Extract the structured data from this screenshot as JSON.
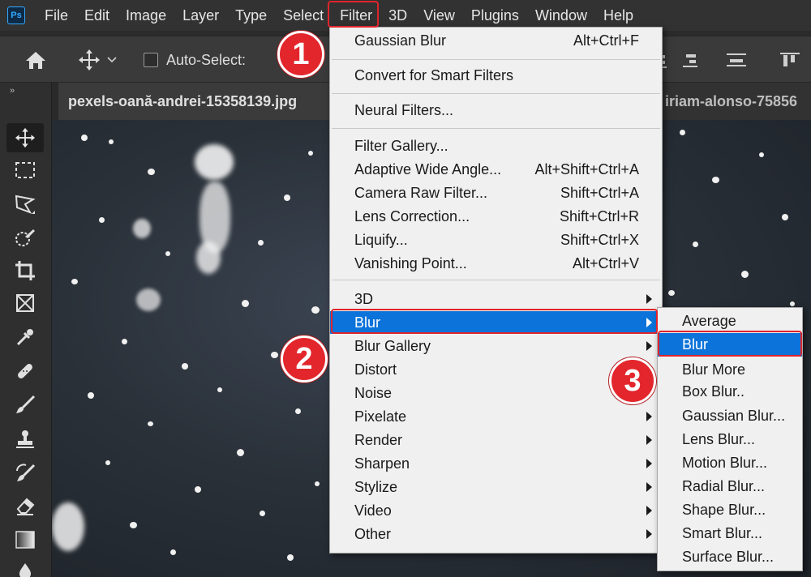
{
  "app": {
    "logo_text": "Ps"
  },
  "menubar": {
    "items": [
      "File",
      "Edit",
      "Image",
      "Layer",
      "Type",
      "Select",
      "Filter",
      "3D",
      "View",
      "Plugins",
      "Window",
      "Help"
    ]
  },
  "options": {
    "auto_select_label": "Auto-Select:"
  },
  "tabs": {
    "active": "pexels-oană-andrei-15358139.jpg",
    "other": "iriam-alonso-75856"
  },
  "filter_menu": {
    "gaussian_blur": {
      "label": "Gaussian Blur",
      "shortcut": "Alt+Ctrl+F"
    },
    "convert_smart": {
      "label": "Convert for Smart Filters"
    },
    "neural": {
      "label": "Neural Filters..."
    },
    "filter_gallery": {
      "label": "Filter Gallery..."
    },
    "adaptive": {
      "label": "Adaptive Wide Angle...",
      "shortcut": "Alt+Shift+Ctrl+A"
    },
    "camera_raw": {
      "label": "Camera Raw Filter...",
      "shortcut": "Shift+Ctrl+A"
    },
    "lens_correction": {
      "label": "Lens Correction...",
      "shortcut": "Shift+Ctrl+R"
    },
    "liquify": {
      "label": "Liquify...",
      "shortcut": "Shift+Ctrl+X"
    },
    "vanishing": {
      "label": "Vanishing Point...",
      "shortcut": "Alt+Ctrl+V"
    },
    "threed": {
      "label": "3D"
    },
    "blur": {
      "label": "Blur"
    },
    "blur_gallery": {
      "label": "Blur Gallery"
    },
    "distort": {
      "label": "Distort"
    },
    "noise": {
      "label": "Noise"
    },
    "pixelate": {
      "label": "Pixelate"
    },
    "render": {
      "label": "Render"
    },
    "sharpen": {
      "label": "Sharpen"
    },
    "stylize": {
      "label": "Stylize"
    },
    "video": {
      "label": "Video"
    },
    "other": {
      "label": "Other"
    }
  },
  "blur_submenu": {
    "items": [
      "Average",
      "Blur",
      "Blur More",
      "Box Blur..",
      "Gaussian Blur...",
      "Lens Blur...",
      "Motion Blur...",
      "Radial Blur...",
      "Shape Blur...",
      "Smart Blur...",
      "Surface Blur..."
    ]
  },
  "callouts": {
    "step1": "1",
    "step2": "2",
    "step3": "3"
  },
  "colors": {
    "highlight": "#0b73d9",
    "callout_red": "#e3262c",
    "menu_bg": "#f0f0f0"
  }
}
